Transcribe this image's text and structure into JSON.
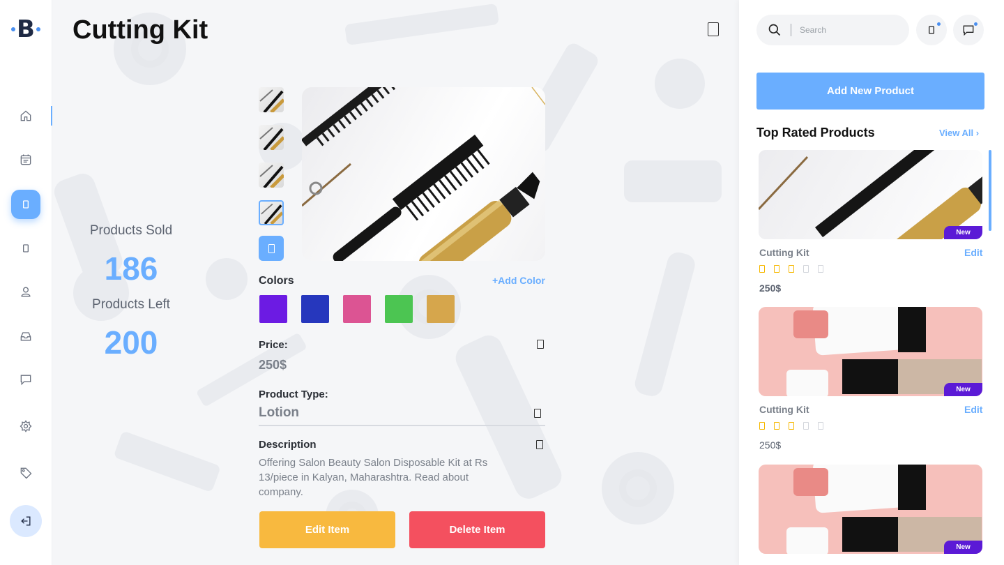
{
  "logo": {
    "letter": "B"
  },
  "nav": {
    "items": [
      {
        "name": "nav-home",
        "icon": "home-icon"
      },
      {
        "name": "nav-calendar",
        "icon": "calendar-icon"
      },
      {
        "name": "nav-products",
        "icon": "box-icon",
        "active": true
      },
      {
        "name": "nav-mobile",
        "icon": "mobile-icon"
      },
      {
        "name": "nav-user",
        "icon": "user-icon"
      },
      {
        "name": "nav-inbox",
        "icon": "inbox-icon"
      },
      {
        "name": "nav-chat",
        "icon": "chat-icon"
      },
      {
        "name": "nav-settings",
        "icon": "gear-icon"
      },
      {
        "name": "nav-tags",
        "icon": "tag-icon"
      }
    ],
    "logout_icon": "logout-icon"
  },
  "main": {
    "title": "Cutting Kit",
    "stats": {
      "sold_label": "Products Sold",
      "sold_value": "186",
      "left_label": "Products Left",
      "left_value": "200"
    },
    "colors": {
      "label": "Colors",
      "add_label": "+Add Color",
      "swatches": [
        "#6c1be3",
        "#2637bd",
        "#dc5493",
        "#4cc552",
        "#d6a64c"
      ]
    },
    "price": {
      "label": "Price:",
      "value": "250$"
    },
    "product_type": {
      "label": "Product Type:",
      "value": "Lotion"
    },
    "description": {
      "label": "Description",
      "text": "Offering Salon Beauty Salon Disposable Kit at Rs 13/piece in Kalyan, Maharashtra. Read about company."
    },
    "buttons": {
      "edit": "Edit Item",
      "delete": "Delete Item"
    }
  },
  "right": {
    "search_placeholder": "Search",
    "add_product": "Add New Product",
    "top_rated_title": "Top Rated Products",
    "view_all": "View All",
    "products": [
      {
        "name": "Cutting Kit",
        "edit": "Edit",
        "rating": 3,
        "max_rating": 5,
        "price": "250$",
        "badge": "New"
      },
      {
        "name": "Cutting Kit",
        "edit": "Edit",
        "rating": 3,
        "max_rating": 5,
        "price": "250$",
        "badge": "New"
      },
      {
        "badge": "New"
      }
    ]
  },
  "colors": {
    "accent": "#6aaeff",
    "edit_button": "#f8b93f",
    "delete_button": "#f4505f",
    "badge": "#5b1ad6",
    "star": "#f6b800"
  }
}
